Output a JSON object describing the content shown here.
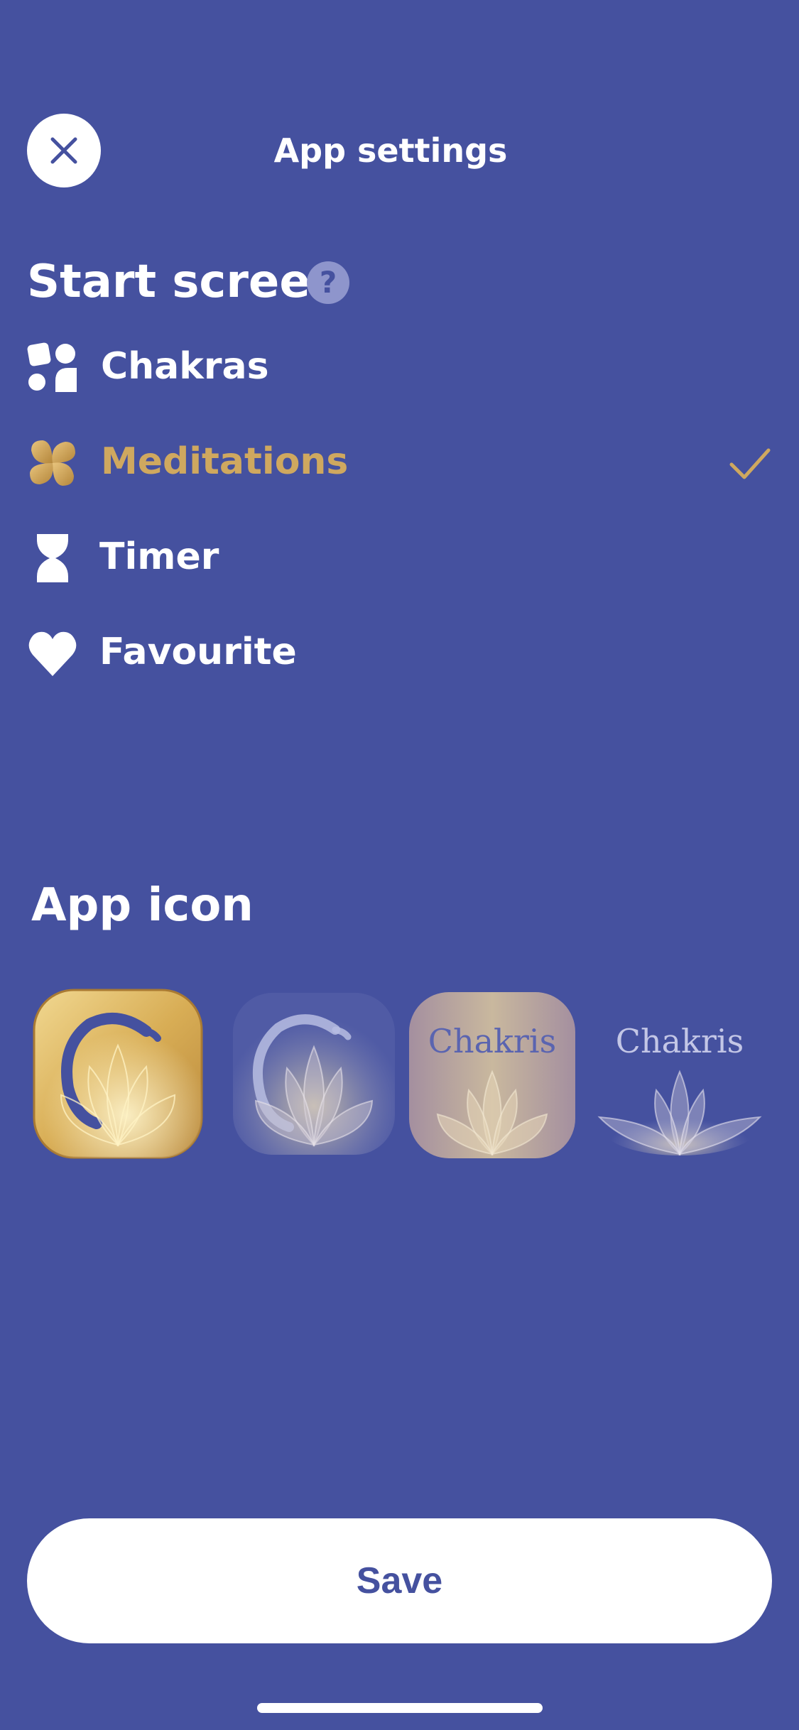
{
  "header": {
    "title": "App settings",
    "close_icon": "close-icon"
  },
  "start_screen": {
    "title": "Start screen",
    "help_label": "?",
    "options": [
      {
        "label": "Chakras",
        "icon": "chakras-icon",
        "selected": false
      },
      {
        "label": "Meditations",
        "icon": "meditations-icon",
        "selected": true
      },
      {
        "label": "Timer",
        "icon": "hourglass-icon",
        "selected": false
      },
      {
        "label": "Favourite",
        "icon": "heart-icon",
        "selected": false
      }
    ]
  },
  "app_icon": {
    "title": "App icon",
    "options": [
      {
        "name": "gold-lotus",
        "selected": true
      },
      {
        "name": "silver-lotus",
        "selected": false
      },
      {
        "name": "chakris-tile",
        "text": "Chakris",
        "selected": false
      },
      {
        "name": "chakris-plain",
        "text": "Chakris",
        "selected": false
      }
    ]
  },
  "save_label": "Save",
  "colors": {
    "background": "#45519f",
    "accent_gold": "#cfa85f",
    "white": "#ffffff"
  }
}
